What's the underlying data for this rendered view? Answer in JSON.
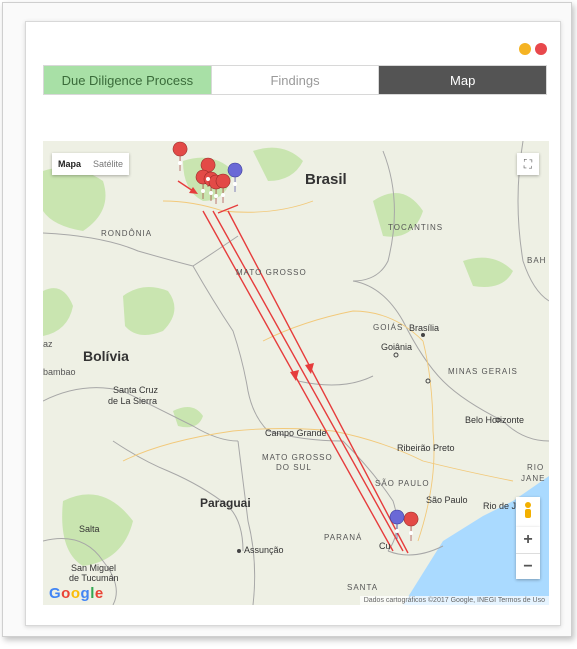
{
  "header": {
    "dots": [
      "#f5b323",
      "#e8484c"
    ]
  },
  "tabs": [
    {
      "label": "Due Diligence Process"
    },
    {
      "label": "Findings"
    },
    {
      "label": "Map"
    }
  ],
  "map": {
    "controls": {
      "map_type_selected": "Mapa",
      "map_type_other": "Satélite",
      "zoom_in": "+",
      "zoom_out": "−"
    },
    "labels": {
      "brasil": "Brasil",
      "rondonia": "RONDÔNIA",
      "tocantins": "TOCANTINS",
      "bah": "BAH",
      "mato_grosso": "MATO GROSSO",
      "goias": "GOIÁS",
      "brasilia": "Brasília",
      "goiania": "Goiânia",
      "az": "az",
      "bolivia": "Bolívia",
      "bambao": "bambao",
      "santa_cruz": "Santa Cruz",
      "de_la_sierra": "de La Sierra",
      "minas_gerais": "MINAS GERAIS",
      "belo_horizonte": "Belo Horizonte",
      "campo_grande": "Campo Grande",
      "ms_line1": "MATO GROSSO",
      "ms_line2": "DO SUL",
      "ribeirao": "Ribeirão Preto",
      "rio": "RIO",
      "jane": "JANE",
      "sao_paulo_state": "SÃO PAULO",
      "sao_paulo": "São Paulo",
      "rio_de": "Rio de J",
      "paraguai": "Paraguai",
      "salta": "Salta",
      "asuncion": "Assunção",
      "parana": "PARANÁ",
      "cu": "Cu",
      "san_miguel": "San Miguel",
      "de_tucuman": "de Tucumán",
      "santa": "SANTA"
    },
    "attribution": "Dados cartográficos ©2017 Google, INEGI   Termos de Uso",
    "logo": "Google"
  }
}
